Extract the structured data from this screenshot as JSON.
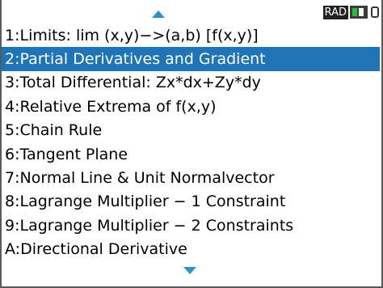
{
  "status": {
    "angle_mode": "RAD",
    "battery_icon": "battery-icon",
    "cable_icon": "cable-icon"
  },
  "scroll": {
    "up_icon": "scroll-up-icon",
    "down_icon": "scroll-down-icon",
    "accent_color": "#2f8fcf"
  },
  "menu": {
    "selected_index": 1,
    "selected_color": "#1f74b8",
    "items": [
      {
        "key": "1:",
        "label": " Limits: lim (x,y)−>(a,b) [f(x,y)]"
      },
      {
        "key": "2:",
        "label": " Partial Derivatives and Gradient"
      },
      {
        "key": "3:",
        "label": " Total Differential: Zx*dx+Zy*dy"
      },
      {
        "key": "4:",
        "label": " Relative Extrema of f(x,y)"
      },
      {
        "key": "5:",
        "label": " Chain Rule"
      },
      {
        "key": "6:",
        "label": " Tangent Plane"
      },
      {
        "key": "7:",
        "label": " Normal Line & Unit Normalvector"
      },
      {
        "key": "8:",
        "label": " Lagrange Multiplier − 1 Constraint"
      },
      {
        "key": "9:",
        "label": " Lagrange Multiplier − 2 Constraints"
      },
      {
        "key": "A:",
        "label": "Directional Derivative"
      }
    ]
  }
}
